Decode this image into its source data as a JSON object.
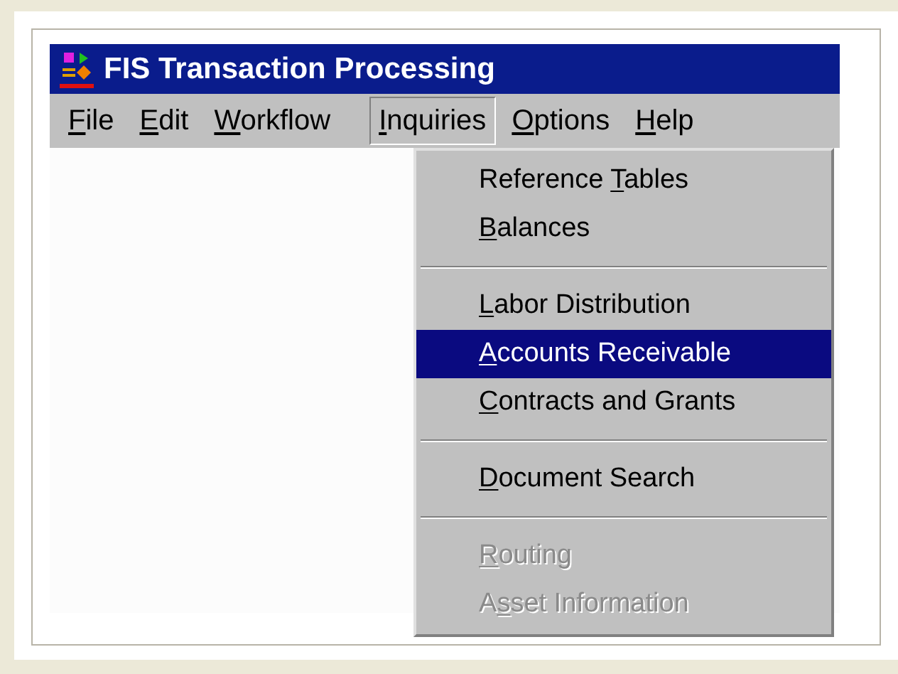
{
  "window": {
    "title": "FIS Transaction Processing"
  },
  "menu_bar": [
    {
      "key": "F",
      "post": "ile",
      "selected": false
    },
    {
      "key": "E",
      "post": "dit",
      "selected": false
    },
    {
      "key": "W",
      "post": "orkflow",
      "selected": false
    },
    {
      "key": "I",
      "post": "nquiries",
      "selected": true
    },
    {
      "key": "O",
      "post": "ptions",
      "selected": false
    },
    {
      "key": "H",
      "post": "elp",
      "selected": false
    }
  ],
  "dropdown": [
    {
      "kind": "item",
      "pre": "Reference ",
      "key": "T",
      "post": "ables",
      "selected": false,
      "disabled": false
    },
    {
      "kind": "item",
      "key": "B",
      "post": "alances",
      "selected": false,
      "disabled": false
    },
    {
      "kind": "separator"
    },
    {
      "kind": "item",
      "key": "L",
      "post": "abor Distribution",
      "selected": false,
      "disabled": false
    },
    {
      "kind": "item",
      "key": "A",
      "post": "ccounts Receivable",
      "selected": true,
      "disabled": false
    },
    {
      "kind": "item",
      "key": "C",
      "post": "ontracts and Grants",
      "selected": false,
      "disabled": false
    },
    {
      "kind": "separator"
    },
    {
      "kind": "item",
      "key": "D",
      "post": "ocument Search",
      "selected": false,
      "disabled": false
    },
    {
      "kind": "separator"
    },
    {
      "kind": "item",
      "key": "R",
      "post": "outing",
      "selected": false,
      "disabled": true
    },
    {
      "kind": "item",
      "pre": "A",
      "key": "s",
      "post": "set Information",
      "selected": false,
      "disabled": true
    }
  ]
}
